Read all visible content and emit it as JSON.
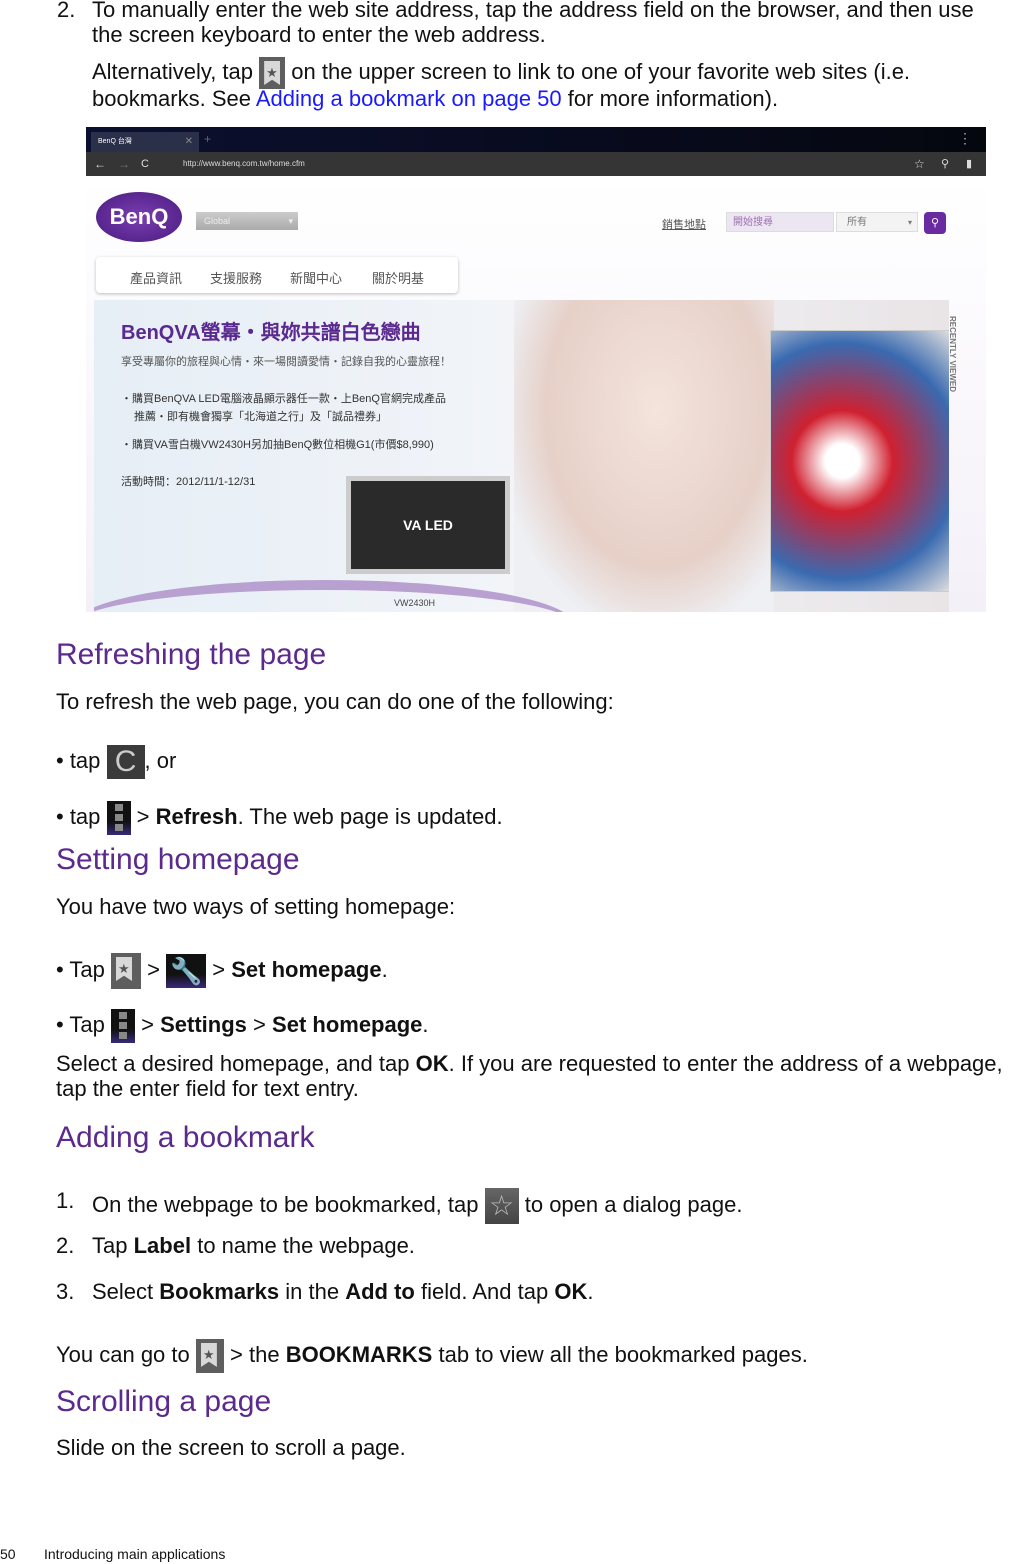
{
  "intro": {
    "step2_number": "2.",
    "step2_line1": "To manually enter the web site address, tap the address field on the browser, and then use",
    "step2_line2": "the screen keyboard to enter the web address.",
    "alt_pre": "Alternatively, tap",
    "alt_post": "on the upper screen to link to one of your favorite web sites (i.e.",
    "alt_line2_pre": "bookmarks. See",
    "alt_link": "Adding a bookmark on page 50",
    "alt_line2_post": "for more information)."
  },
  "browser": {
    "tab_title": "BenQ 台灣",
    "url": "http://www.benq.com.tw/home.cfm",
    "logo": "BenQ",
    "region_select": "Global",
    "nav": [
      "產品資訊",
      "支援服務",
      "新聞中心",
      "關於明基"
    ],
    "store_link": "銷售地點",
    "search_placeholder": "開始搜尋",
    "search_scope": "所有",
    "recently_viewed": "RECENTLY VIEWED",
    "ad": {
      "title": "BenQVA螢幕・與妳共譜白色戀曲",
      "subtitle": "享受專屬你的旅程與心情・來一場閱讀愛情・記錄自我的心靈旅程！",
      "bullet1_line1": "・購買BenQVA LED電腦液晶顯示器任一款・上BenQ官網完成產品",
      "bullet1_line2": "推薦・即有機會獨享「北海道之行」及「誠品禮券」",
      "bullet2": "・購買VA雪白機VW2430H另加抽BenQ數位相機G1(市價$8,990)",
      "period": "活動時間：2012/11/1-12/31",
      "monitor_badge": "VA LED",
      "monitor_model": "VW2430H"
    }
  },
  "refresh": {
    "heading": "Refreshing the page",
    "text": "To refresh the web page, you can do one of the following:",
    "b1_pre": "• tap",
    "b1_post": ", or",
    "b2_pre": "• tap",
    "b2_gt": ">",
    "b2_bold": "Refresh",
    "b2_post": ". The web page is updated."
  },
  "homepage": {
    "heading": "Setting homepage",
    "text": "You have two ways of setting homepage:",
    "b1_pre": "• Tap",
    "gt": ">",
    "b1_bold": "Set homepage",
    "b2_pre": "• Tap",
    "b2_bold1": "Settings",
    "b2_bold2": "Set homepage",
    "period": ".",
    "select_pre": "Select a desired homepage, and tap",
    "select_ok": "OK",
    "select_post": ". If you are requested to enter the address of a webpage,",
    "select_line2": "tap the enter field for text entry."
  },
  "bookmark": {
    "heading": "Adding a bookmark",
    "s1_num": "1.",
    "s1_pre": "On the webpage to be bookmarked, tap",
    "s1_post": "to open a dialog page.",
    "s2_num": "2.",
    "s2_pre": "Tap",
    "s2_bold": "Label",
    "s2_post": "to name the webpage.",
    "s3_num": "3.",
    "s3_pre": "Select",
    "s3_bold1": "Bookmarks",
    "s3_mid": "in the",
    "s3_bold2": "Add to",
    "s3_mid2": "field. And tap",
    "s3_bold3": "OK",
    "goto_pre": "You can go to",
    "goto_mid": "> the",
    "goto_bold": "BOOKMARKS",
    "goto_post": "tab to view all the bookmarked pages."
  },
  "scrolling": {
    "heading": "Scrolling a page",
    "text": "Slide on the screen to scroll a page."
  },
  "footer": {
    "page_number": "50",
    "section": "Introducing main applications"
  },
  "colors": {
    "heading": "#5b2a8c",
    "link": "#1a1aff",
    "brand": "#5a2a90"
  }
}
